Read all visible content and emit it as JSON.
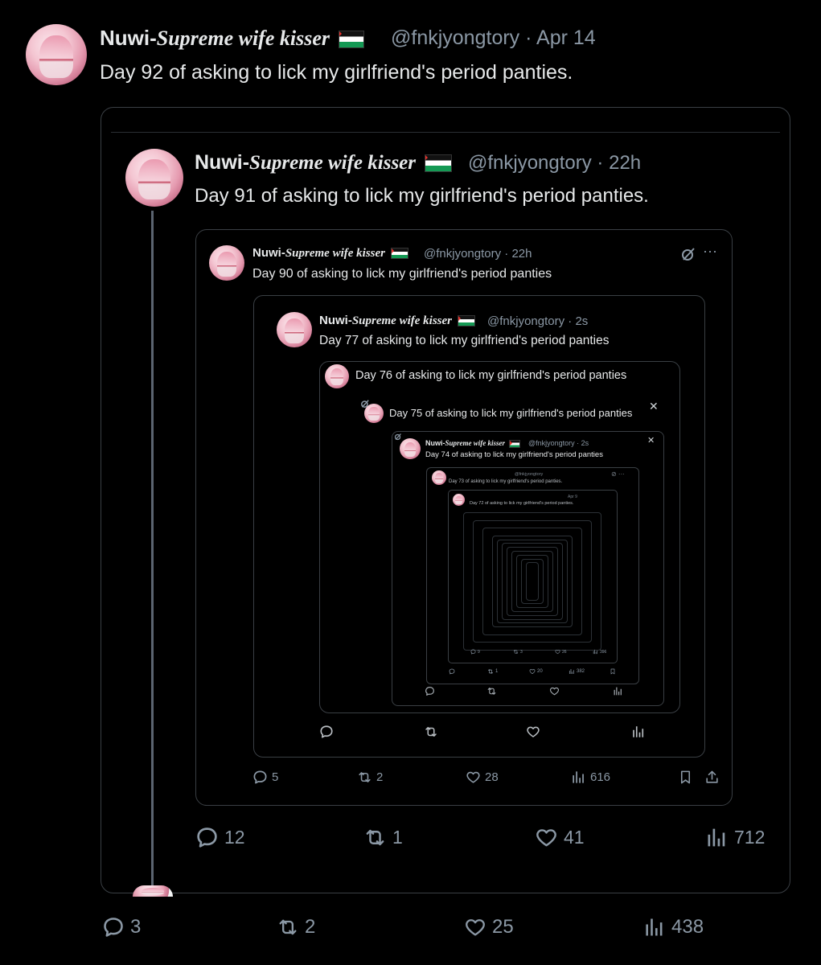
{
  "author": {
    "name_prefix": "Nuwi-",
    "name_styled": "Supreme wife kisser",
    "handle": "@fnkjyongtory"
  },
  "tweets": [
    {
      "time": "Apr 14",
      "text": "Day 92 of asking to lick my girlfriend's period panties.",
      "replies": "3",
      "retweets": "2",
      "likes": "25",
      "views": "438"
    },
    {
      "time": "22h",
      "text": "Day 91 of asking to lick my girlfriend's period panties.",
      "replies": "12",
      "retweets": "1",
      "likes": "41",
      "views": "712"
    },
    {
      "time": "22h",
      "text": "Day 90 of asking to lick my girlfriend's period panties",
      "replies": "5",
      "retweets": "2",
      "likes": "28",
      "views": "616"
    },
    {
      "time": "2s",
      "text": "Day 77 of asking to lick my girlfriend's period panties"
    },
    {
      "text": "Day 76 of asking to lick my girlfriend's period panties"
    },
    {
      "text": "Day 75 of asking to lick my girlfriend's period panties"
    },
    {
      "time": "2s",
      "text": "Day 74 of asking to lick my girlfriend's period panties"
    },
    {
      "time": "22h",
      "text": "Day 73 of asking to lick my girlfriend's period panties."
    },
    {
      "time": "Apr 9",
      "text": "Day 72 of asking to lick my girlfriend's period panties."
    }
  ],
  "deep_stats": [
    {
      "replies": "9",
      "retweets": "3",
      "likes": "26",
      "views": "396"
    },
    {
      "replies": "",
      "retweets": "1",
      "likes": "20",
      "views": "382"
    }
  ],
  "icons": {
    "reply": "speech-bubble-icon",
    "retweet": "retweet-icon",
    "like": "heart-icon",
    "views": "bar-chart-icon",
    "bookmark": "bookmark-icon",
    "share": "share-icon",
    "close": "close-icon",
    "more": "more-icon",
    "grok": "grok-icon"
  },
  "colors": {
    "background": "#000000",
    "text": "#e7e9ea",
    "muted": "#8b98a5",
    "border": "#3a3f44"
  }
}
